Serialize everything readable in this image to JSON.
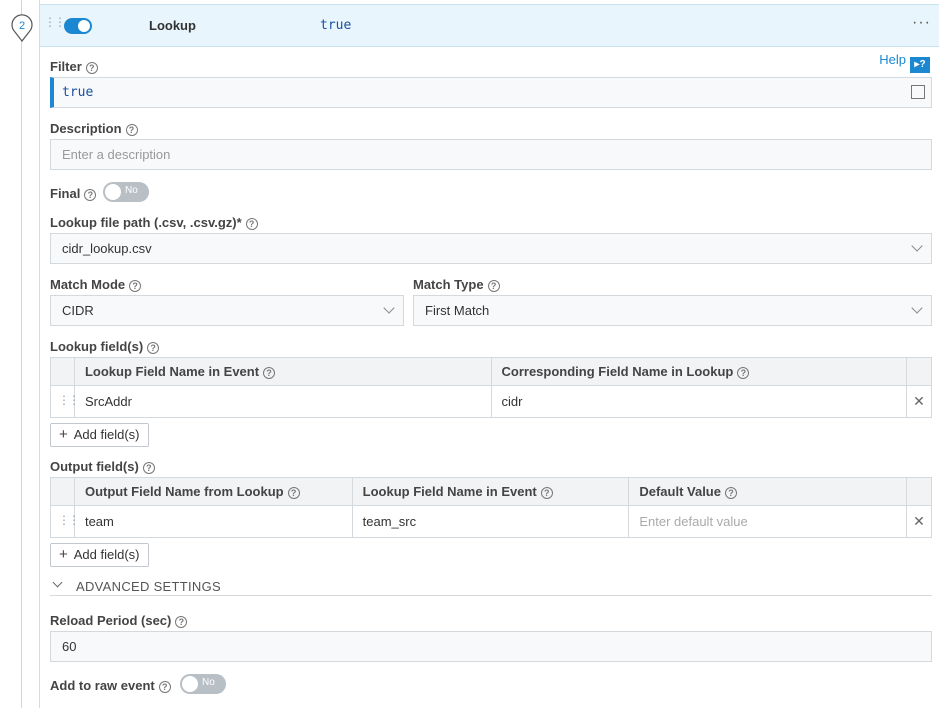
{
  "step_number": "2",
  "header": {
    "function_name": "Lookup",
    "filter_value": "true",
    "more_label": "···"
  },
  "help": {
    "label": "Help",
    "icon": "?"
  },
  "filter": {
    "label": "Filter",
    "value": "true"
  },
  "description": {
    "label": "Description",
    "placeholder": "Enter a description"
  },
  "final": {
    "label": "Final",
    "toggle_text": "No"
  },
  "lookup_file": {
    "label": "Lookup file path (.csv, .csv.gz)*",
    "value": "cidr_lookup.csv"
  },
  "match_mode": {
    "label": "Match Mode",
    "value": "CIDR"
  },
  "match_type": {
    "label": "Match Type",
    "value": "First Match"
  },
  "lookup_fields": {
    "label": "Lookup field(s)",
    "columns": [
      "Lookup Field Name in Event",
      "Corresponding Field Name in Lookup"
    ],
    "rows": [
      [
        "SrcAddr",
        "cidr"
      ]
    ],
    "add_label": "Add field(s)"
  },
  "output_fields": {
    "label": "Output field(s)",
    "columns": [
      "Output Field Name from Lookup",
      "Lookup Field Name in Event",
      "Default Value"
    ],
    "rows": [
      {
        "output": "team",
        "event": "team_src",
        "default_placeholder": "Enter default value"
      }
    ],
    "add_label": "Add field(s)"
  },
  "advanced": {
    "label": "ADVANCED SETTINGS"
  },
  "reload_period": {
    "label": "Reload Period (sec)",
    "value": "60"
  },
  "add_raw": {
    "label": "Add to raw event",
    "toggle_text": "No"
  },
  "icons": {
    "remove": "✕",
    "plus": "+",
    "help_q": "?"
  }
}
